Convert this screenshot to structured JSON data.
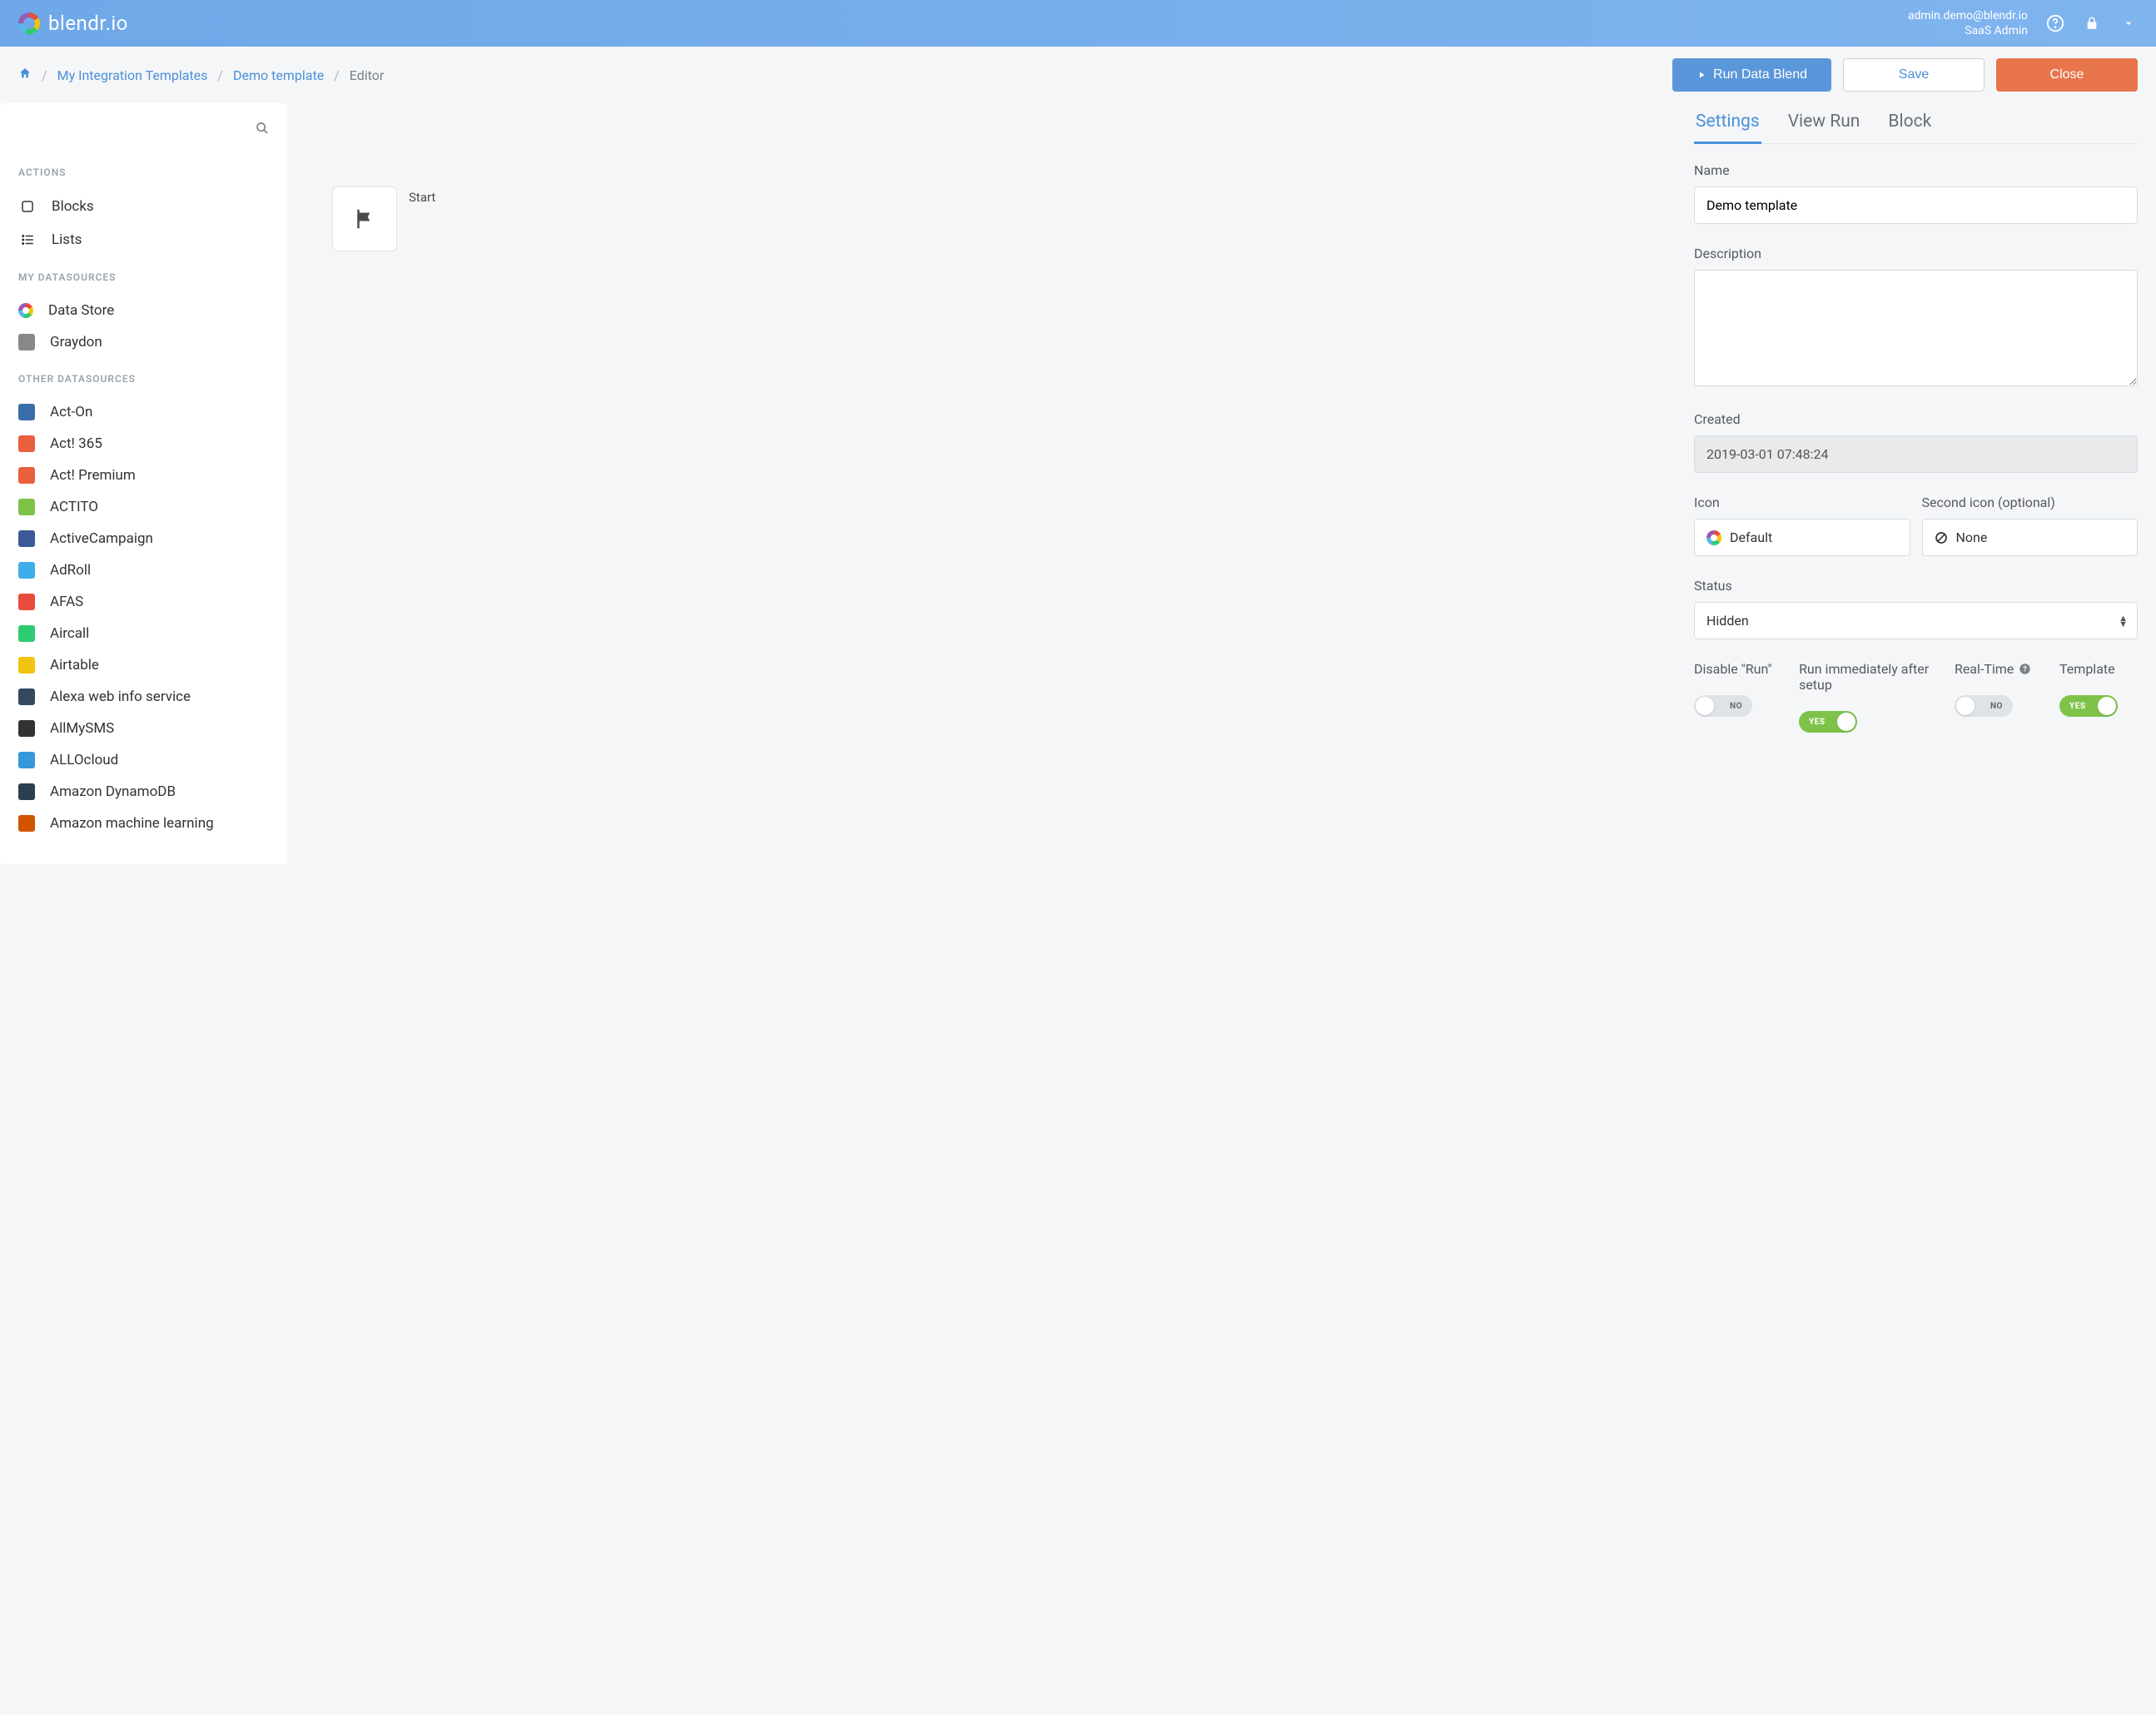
{
  "brand": "blendr.io",
  "user": {
    "email": "admin.demo@blendr.io",
    "role": "SaaS Admin"
  },
  "breadcrumb": {
    "templates": "My Integration Templates",
    "demo": "Demo template",
    "editor": "Editor"
  },
  "actions": {
    "run": "Run Data Blend",
    "save": "Save",
    "close": "Close"
  },
  "sidebar": {
    "actions_head": "ACTIONS",
    "blocks": "Blocks",
    "lists": "Lists",
    "my_ds_head": "MY DATASOURCES",
    "data_store": "Data Store",
    "graydon": "Graydon",
    "other_ds_head": "OTHER DATASOURCES",
    "items": [
      {
        "label": "Act-On",
        "bg": "#3b6ea8"
      },
      {
        "label": "Act! 365",
        "bg": "#e8603c"
      },
      {
        "label": "Act! Premium",
        "bg": "#e8603c"
      },
      {
        "label": "ACTITO",
        "bg": "#7fc24a"
      },
      {
        "label": "ActiveCampaign",
        "bg": "#3b5998"
      },
      {
        "label": "AdRoll",
        "bg": "#3daee9"
      },
      {
        "label": "AFAS",
        "bg": "#e74c3c"
      },
      {
        "label": "Aircall",
        "bg": "#2ecc71"
      },
      {
        "label": "Airtable",
        "bg": "#f1c40f"
      },
      {
        "label": "Alexa web info service",
        "bg": "#34495e"
      },
      {
        "label": "AllMySMS",
        "bg": "#333333"
      },
      {
        "label": "ALLOcloud",
        "bg": "#3498db"
      },
      {
        "label": "Amazon DynamoDB",
        "bg": "#2c3e50"
      },
      {
        "label": "Amazon machine learning",
        "bg": "#d35400"
      }
    ]
  },
  "canvas": {
    "start": "Start"
  },
  "panel": {
    "tabs": {
      "settings": "Settings",
      "view_run": "View Run",
      "block": "Block"
    },
    "labels": {
      "name": "Name",
      "description": "Description",
      "created": "Created",
      "icon": "Icon",
      "second_icon": "Second icon (optional)",
      "status": "Status",
      "disable_run": "Disable \"Run\"",
      "run_after_setup": "Run immediately after setup",
      "real_time": "Real-Time",
      "template": "Template"
    },
    "values": {
      "name": "Demo template",
      "description": "",
      "created": "2019-03-01 07:48:24",
      "icon": "Default",
      "second_icon": "None",
      "status": "Hidden"
    },
    "toggles": {
      "disable_run": "NO",
      "run_after_setup": "YES",
      "real_time": "NO",
      "template": "YES"
    }
  }
}
